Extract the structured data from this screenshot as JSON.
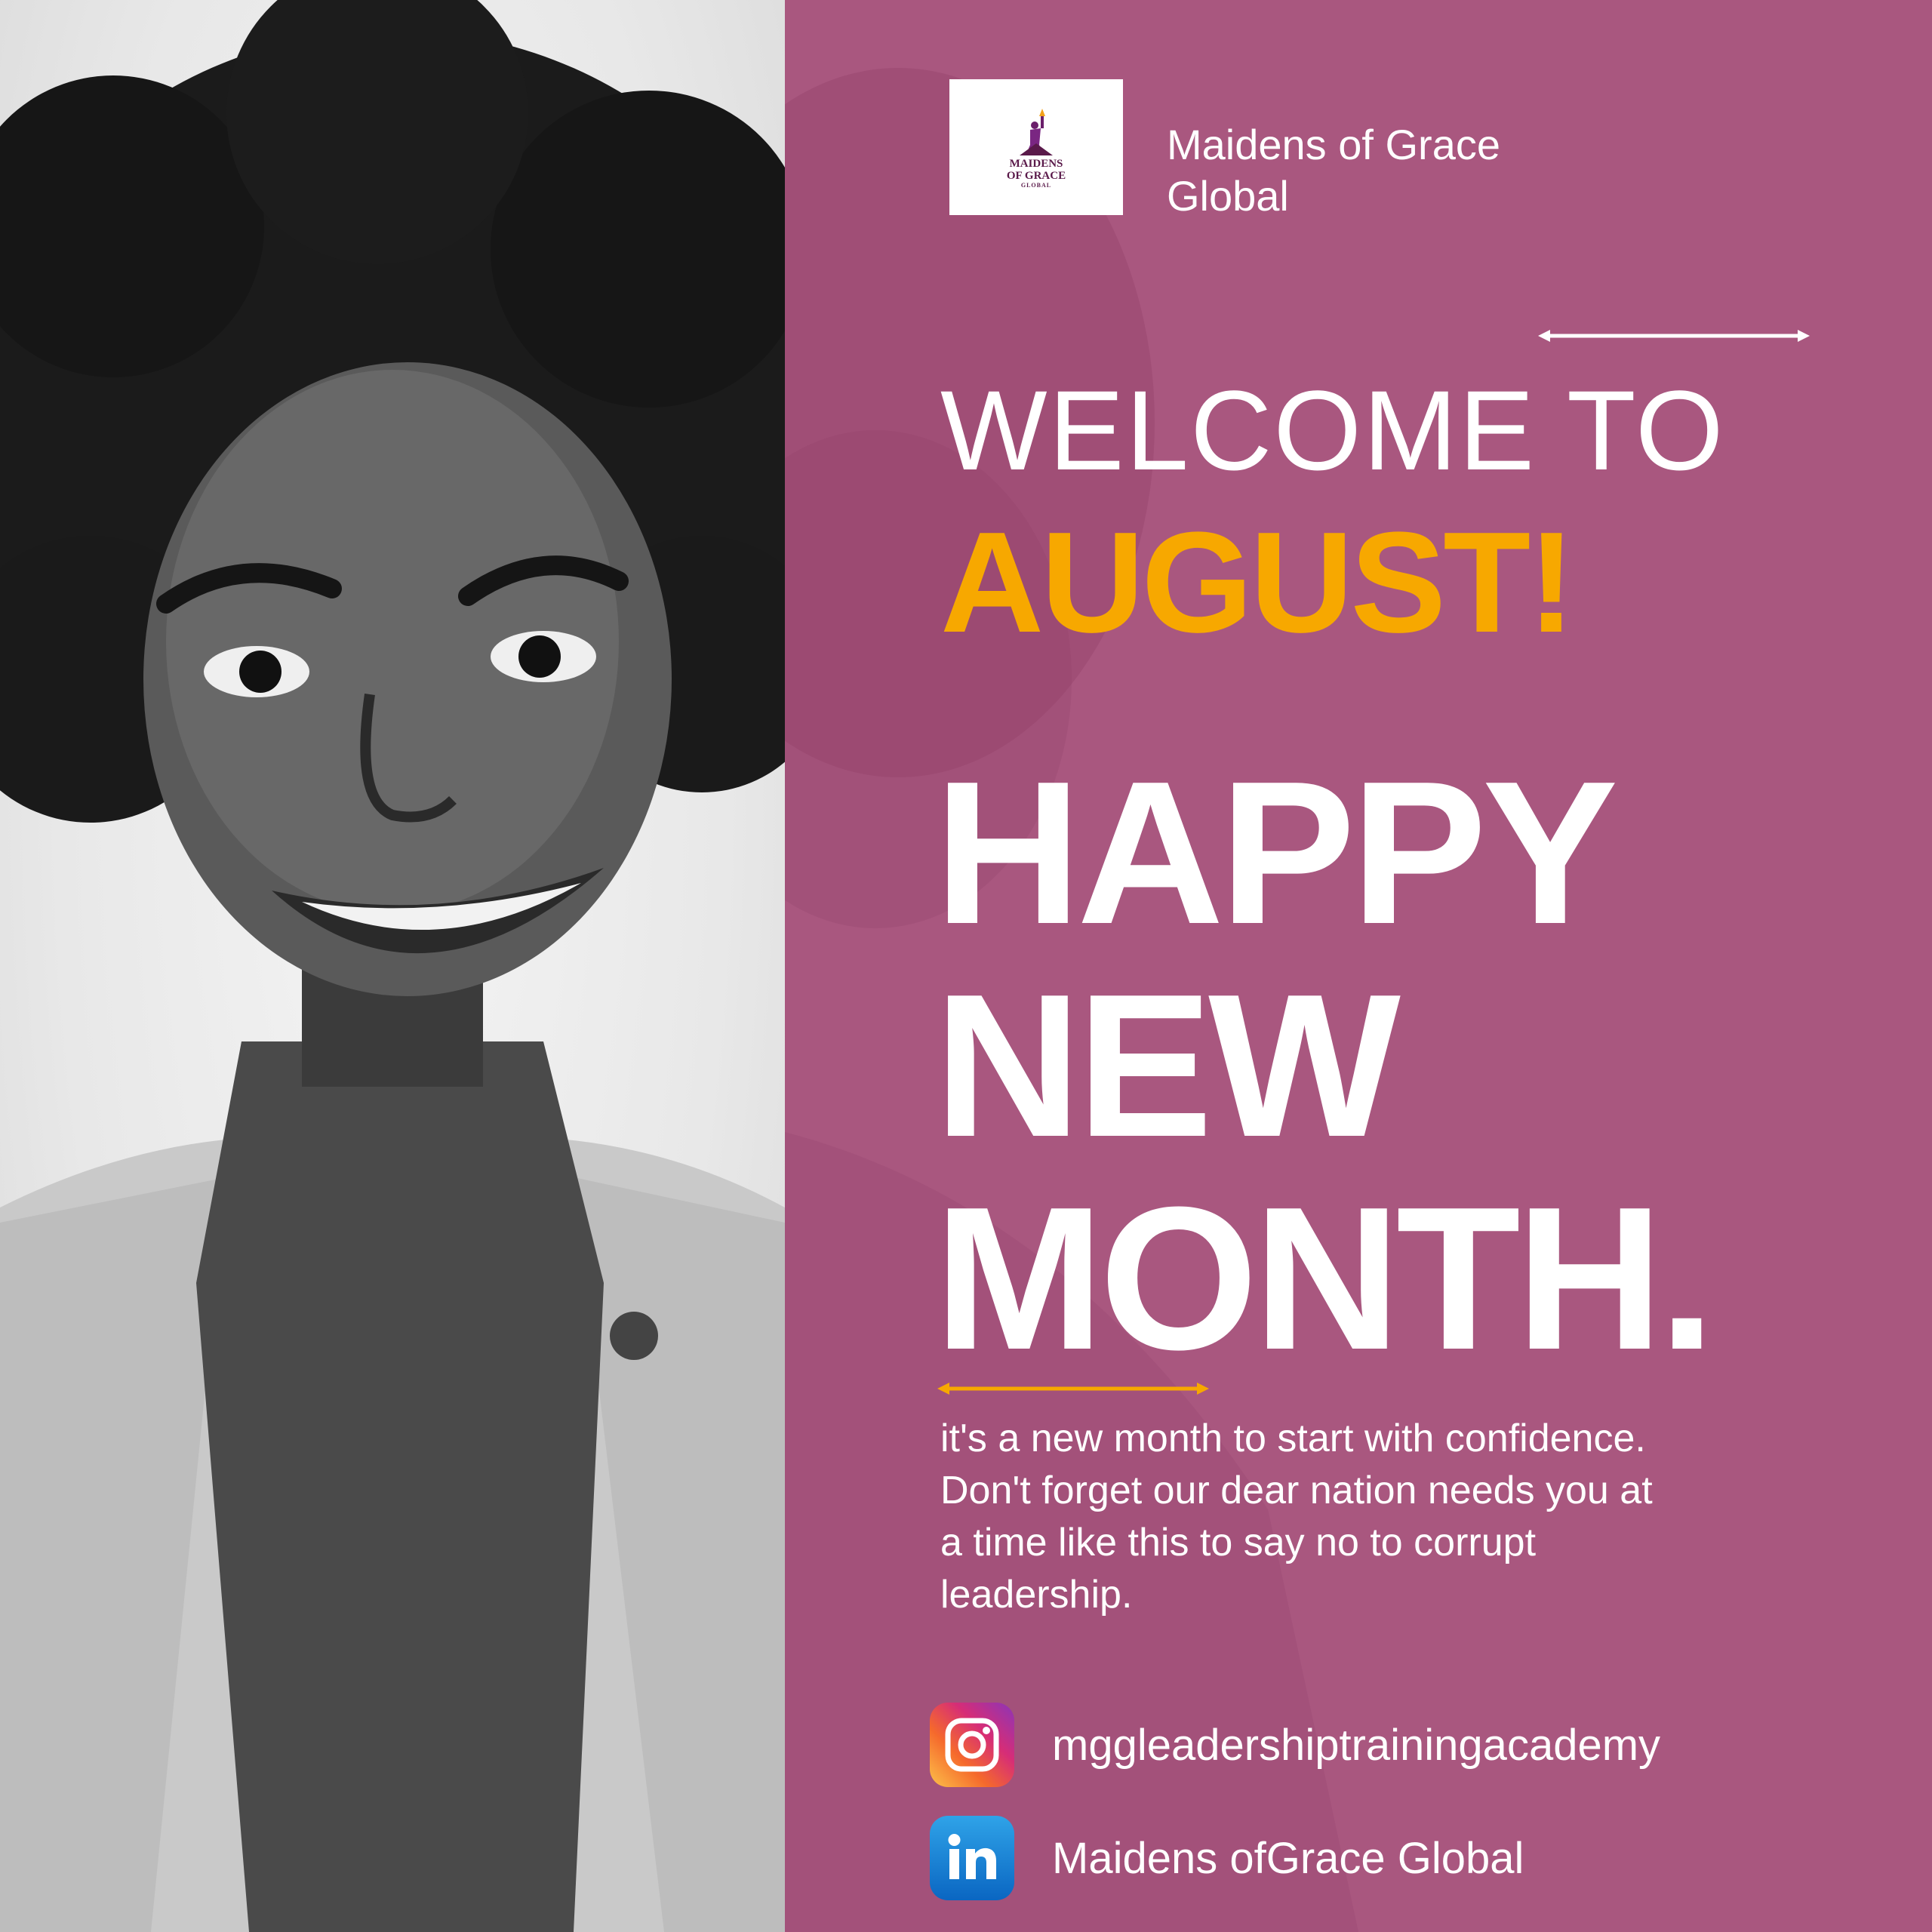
{
  "brand": {
    "logo_lines": [
      "MAIDENS",
      "OF GRACE",
      "GLOBAL"
    ],
    "name_lines": [
      "Maidens of Grace",
      "Global"
    ]
  },
  "headline": {
    "welcome": "WELCOME TO",
    "month": "AUGUST!",
    "greeting_lines": [
      "HAPPY",
      "NEW",
      "MONTH."
    ]
  },
  "message": "it's a new month to start with confidence. Don't forget our dear nation needs you at a time like this to say no to corrupt leadership.",
  "social": {
    "instagram": {
      "icon": "instagram-icon",
      "handle": "mggleadershiptrainingacademy"
    },
    "linkedin": {
      "icon": "linkedin-icon",
      "handle": "Maidens ofGrace Global"
    }
  },
  "colors": {
    "panel": "#a9577f",
    "accent": "#f7a800",
    "text": "#ffffff"
  }
}
